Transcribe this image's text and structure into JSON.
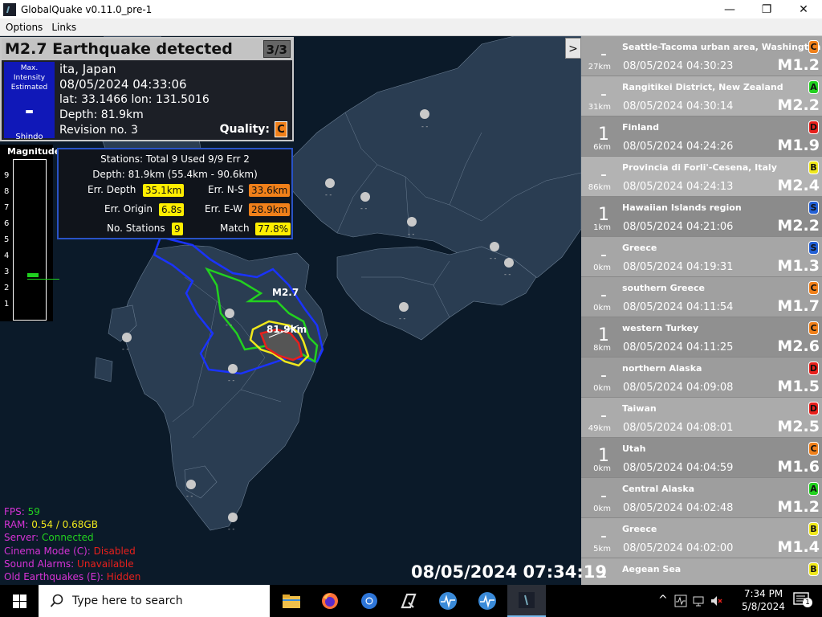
{
  "window": {
    "title": "GlobalQuake v0.11.0_pre-1",
    "minimize_glyph": "—",
    "maximize_glyph": "❐",
    "close_glyph": "✕"
  },
  "menu": [
    "Options",
    "Links"
  ],
  "quake_panel": {
    "header": "M2.7 Earthquake detected",
    "count": "3/3",
    "shindo_label_top": "Max. Intensity",
    "shindo_label_mid": "Estimated",
    "shindo_value": "-",
    "shindo_label_bottom": "Shindo",
    "region": "ita, Japan",
    "datetime": "08/05/2024 04:33:06",
    "latlon": "lat: 33.1466 lon: 131.5016",
    "depth": "Depth: 81.9km",
    "revision": "Revision no. 3",
    "quality_label": "Quality:",
    "quality": "C",
    "colors": {
      "shindo_box": "#1018b8",
      "quality": "#f0801a"
    }
  },
  "magnitude": {
    "title": "Magnitude",
    "ticks": [
      "9",
      "8",
      "7",
      "6",
      "5",
      "4",
      "3",
      "2",
      "1"
    ],
    "value": 2.7
  },
  "stats": {
    "line1": "Stations: Total 9 Used 9/9 Err 2",
    "line2": "Depth: 81.9km (55.4km - 90.6km)",
    "err_depth_label": "Err. Depth",
    "err_depth": "35.1km",
    "err_ns_label": "Err. N-S",
    "err_ns": "33.6km",
    "err_origin_label": "Err. Origin",
    "err_origin": "6.8s",
    "err_ew_label": "Err. E-W",
    "err_ew": "28.9km",
    "stations_label": "No. Stations",
    "stations": "9",
    "match_label": "Match",
    "match": "77.8%"
  },
  "collapse_glyph": ">",
  "map_labels": {
    "mag": "M2.7",
    "depth": "81.9km"
  },
  "earthquakes": [
    {
      "intensity": "-",
      "depth": "27km",
      "region": "Seattle-Tacoma urban area, Washington",
      "time": "08/05/2024 04:30:23",
      "mag": "M1.2",
      "quality": "C",
      "qcolor": "#f0801a",
      "bg": "#a3a3a3"
    },
    {
      "intensity": "-",
      "depth": "31km",
      "region": "Rangitikei District, New Zealand",
      "time": "08/05/2024 04:30:14",
      "mag": "M2.2",
      "quality": "A",
      "qcolor": "#22d11f",
      "bg": "#b0b0b0"
    },
    {
      "intensity": "1",
      "depth": "6km",
      "region": "Finland",
      "time": "08/05/2024 04:24:26",
      "mag": "M1.9",
      "quality": "D",
      "qcolor": "#e8201c",
      "bg": "#929292"
    },
    {
      "intensity": "-",
      "depth": "86km",
      "region": "Provincia di Forli'-Cesena, Italy",
      "time": "08/05/2024 04:24:13",
      "mag": "M2.4",
      "quality": "B",
      "qcolor": "#f0e81c",
      "bg": "#b3b3b3"
    },
    {
      "intensity": "1",
      "depth": "1km",
      "region": "Hawaiian Islands region",
      "time": "08/05/2024 04:21:06",
      "mag": "M2.2",
      "quality": "S",
      "qcolor": "#2360d6",
      "bg": "#8b8b8b"
    },
    {
      "intensity": "-",
      "depth": "0km",
      "region": "Greece",
      "time": "08/05/2024 04:19:31",
      "mag": "M1.3",
      "quality": "S",
      "qcolor": "#2360d6",
      "bg": "#a6a6a6"
    },
    {
      "intensity": "-",
      "depth": "0km",
      "region": "southern Greece",
      "time": "08/05/2024 04:11:54",
      "mag": "M1.7",
      "quality": "C",
      "qcolor": "#f0801a",
      "bg": "#a0a0a0"
    },
    {
      "intensity": "1",
      "depth": "8km",
      "region": "western Turkey",
      "time": "08/05/2024 04:11:25",
      "mag": "M2.6",
      "quality": "C",
      "qcolor": "#f0801a",
      "bg": "#909090"
    },
    {
      "intensity": "-",
      "depth": "0km",
      "region": "northern Alaska",
      "time": "08/05/2024 04:09:08",
      "mag": "M1.5",
      "quality": "D",
      "qcolor": "#e8201c",
      "bg": "#9c9c9c"
    },
    {
      "intensity": "-",
      "depth": "49km",
      "region": "Taiwan",
      "time": "08/05/2024 04:08:01",
      "mag": "M2.5",
      "quality": "D",
      "qcolor": "#e8201c",
      "bg": "#ababab"
    },
    {
      "intensity": "1",
      "depth": "0km",
      "region": "Utah",
      "time": "08/05/2024 04:04:59",
      "mag": "M1.6",
      "quality": "C",
      "qcolor": "#f0801a",
      "bg": "#8f8f8f"
    },
    {
      "intensity": "-",
      "depth": "0km",
      "region": "Central Alaska",
      "time": "08/05/2024 04:02:48",
      "mag": "M1.2",
      "quality": "A",
      "qcolor": "#22d11f",
      "bg": "#9e9e9e"
    },
    {
      "intensity": "-",
      "depth": "5km",
      "region": "Greece",
      "time": "08/05/2024 04:02:00",
      "mag": "M1.4",
      "quality": "B",
      "qcolor": "#f0e81c",
      "bg": "#a8a8a8"
    },
    {
      "intensity": "-",
      "depth": "",
      "region": "Aegean Sea",
      "time": "",
      "mag": "",
      "quality": "B",
      "qcolor": "#f0e81c",
      "bg": "#aaaaaa"
    }
  ],
  "status": [
    {
      "label": "FPS: ",
      "value": "59",
      "label_color": "#d633d6",
      "value_color": "#22d11f"
    },
    {
      "label": "RAM: ",
      "value": "0.54 / 0.68GB",
      "label_color": "#d633d6",
      "value_color": "#f0e81c"
    },
    {
      "label": "Server: ",
      "value": "Connected",
      "label_color": "#d633d6",
      "value_color": "#22d11f"
    },
    {
      "label": "Cinema Mode (C): ",
      "value": "Disabled",
      "label_color": "#d633d6",
      "value_color": "#e8201c"
    },
    {
      "label": "Sound Alarms: ",
      "value": "Unavailable",
      "label_color": "#d633d6",
      "value_color": "#e8201c"
    },
    {
      "label": "Old Earthquakes (E): ",
      "value": "Hidden",
      "label_color": "#d633d6",
      "value_color": "#e8201c"
    }
  ],
  "clock": "08/05/2024 07:34:19",
  "station_labels": "- -",
  "taskbar": {
    "search_placeholder": "Type here to search",
    "tray_time": "7:34 PM",
    "tray_date": "5/8/2024",
    "notification_count": "1"
  }
}
